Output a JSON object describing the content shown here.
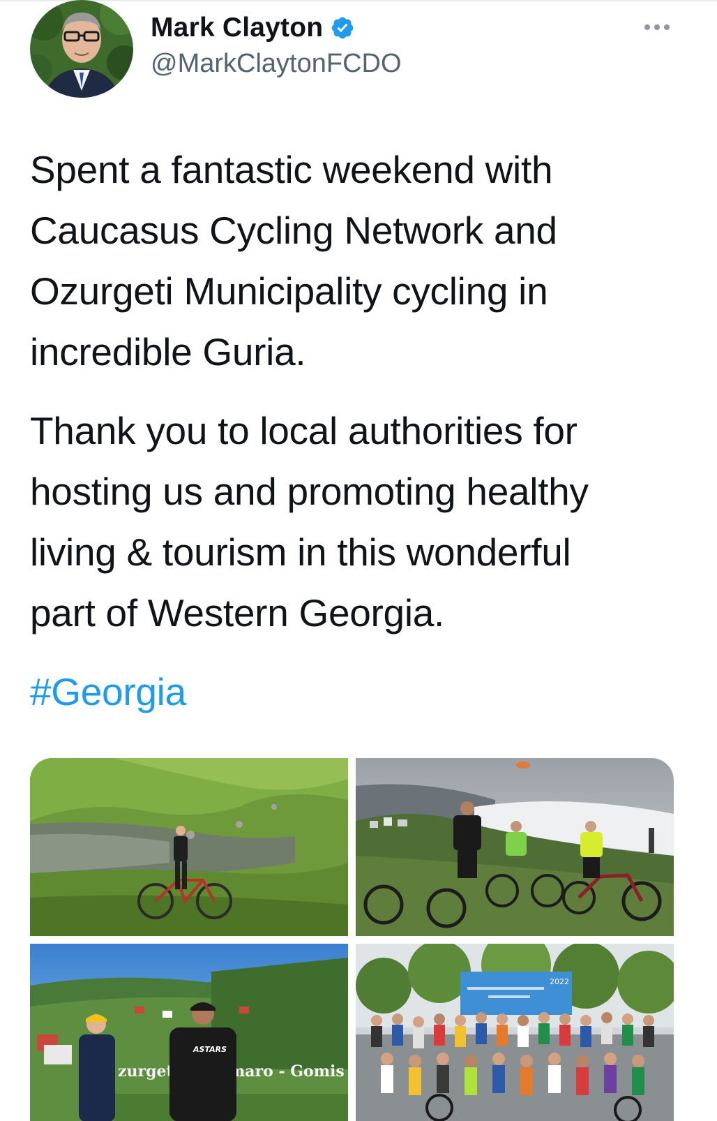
{
  "tweet": {
    "author": {
      "display_name": "Mark Clayton",
      "handle": "@MarkClaytonFCDO",
      "verified": true,
      "avatar_icon": "profile-photo"
    },
    "more_icon": "more-options-icon",
    "paragraph_1": "Spent a fantastic weekend with\nCaucasus Cycling Network and\nOzurgeti Municipality cycling in\nincredible Guria.",
    "paragraph_2": "Thank you to local authorities for\nhosting us and promoting healthy\nliving & tourism in this wonderful\npart of Western Georgia.",
    "hashtag": "#Georgia",
    "media": [
      {
        "scene": "cyclist-by-mountain-lake"
      },
      {
        "scene": "cyclists-above-clouds"
      },
      {
        "scene": "speakers-at-banner",
        "sign_text_left": "zurget",
        "sign_text_right": "maro - Gomis",
        "jersey_text": "ASTARS"
      },
      {
        "scene": "group-photo-with-banner",
        "banner_text": "2022"
      }
    ]
  },
  "colors": {
    "text": "#0f1419",
    "secondary": "#536471",
    "link": "#1d9bf0",
    "verified": "#1d9bf0"
  }
}
